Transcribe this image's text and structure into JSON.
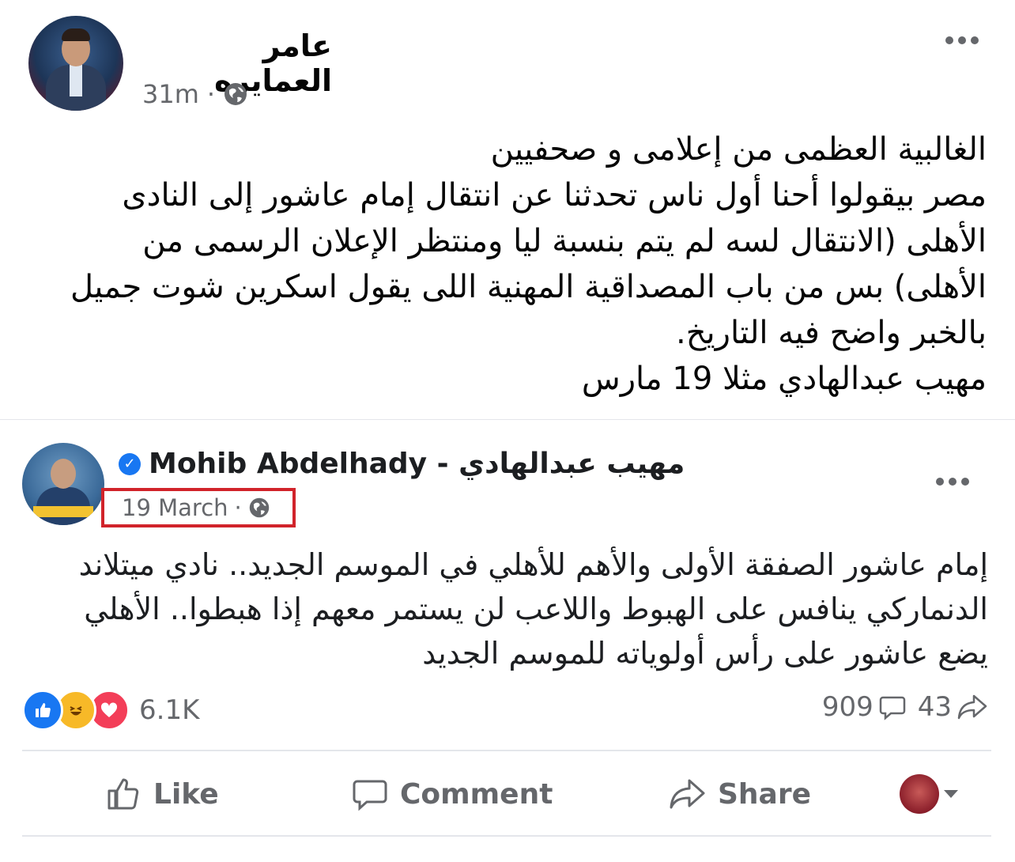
{
  "outer_post": {
    "author": "عامر العمايره",
    "time": "31m",
    "separator": "·",
    "text_lines": [
      "الغالبية العظمى من إعلامى و صحفيين",
      "مصر بيقولوا أحنا أول ناس تحدثنا عن انتقال إمام عاشور إلى النادى",
      "الأهلى (الانتقال لسه لم يتم بنسبة ليا ومنتظر الإعلان الرسمى من",
      "الأهلى) بس من باب المصداقية المهنية اللى يقول اسكرين شوت جميل",
      "بالخبر واضح فيه التاريخ.",
      "مهيب عبدالهادي مثلا 19 مارس"
    ]
  },
  "shared_post": {
    "author": "Mohib Abdelhady - مهيب عبدالهادي",
    "date": "19 March",
    "separator": "·",
    "text_lines": [
      "إمام عاشور الصفقة الأولى والأهم للأهلي في الموسم الجديد.. نادي ميتلاند",
      "الدنماركي ينافس على الهبوط واللاعب لن يستمر معهم إذا هبطوا.. الأهلي",
      "يضع عاشور على رأس أولوياته للموسم الجديد"
    ],
    "reaction_count": "6.1K",
    "comment_count": "909",
    "share_count": "43"
  },
  "actions": {
    "like": "Like",
    "comment": "Comment",
    "share": "Share"
  },
  "colors": {
    "highlight_box": "#d1232a",
    "like_blue": "#1877f2",
    "love_red": "#f33e58",
    "haha_yellow": "#f7b928",
    "muted_text": "#65676b"
  }
}
